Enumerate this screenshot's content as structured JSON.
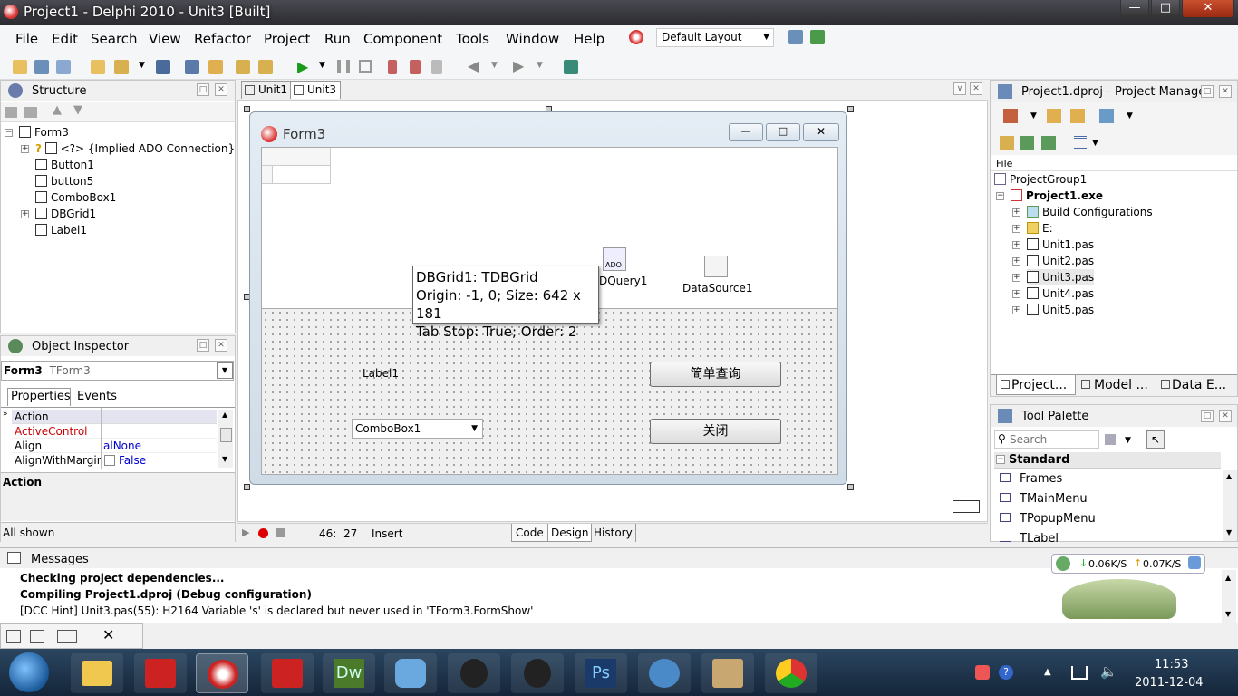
{
  "window": {
    "title": "Project1 - Delphi 2010 - Unit3 [Built]",
    "min": "—",
    "max": "□",
    "close": "✕"
  },
  "menu": [
    "File",
    "Edit",
    "Search",
    "View",
    "Refactor",
    "Project",
    "Run",
    "Component",
    "Tools",
    "Window",
    "Help"
  ],
  "layout_select": "Default Layout",
  "structure": {
    "title": "Structure",
    "items": [
      "Form3",
      "<?> {Implied ADO Connection}",
      "Button1",
      "button5",
      "ComboBox1",
      "DBGrid1",
      "Label1"
    ]
  },
  "inspector": {
    "title": "Object Inspector",
    "object_name": "Form3",
    "object_type": "TForm3",
    "tabs": [
      "Properties",
      "Events"
    ],
    "rows": [
      {
        "name": "Action",
        "value": ""
      },
      {
        "name": "ActiveControl",
        "value": ""
      },
      {
        "name": "Align",
        "value": "alNone"
      },
      {
        "name": "AlignWithMargins",
        "value": "False"
      }
    ],
    "desc_title": "Action",
    "status": "All shown"
  },
  "editor": {
    "tabs": [
      "Unit1",
      "Unit3"
    ],
    "form_title": "Form3",
    "tooltip": [
      "DBGrid1: TDBGrid",
      "Origin: -1, 0; Size: 642 x 181",
      "Tab Stop: True; Order: 2"
    ],
    "ado_label": "ADO",
    "query_label": "DQuery1",
    "datasource_label": "DataSource1",
    "label1": "Label1",
    "combo": "ComboBox1",
    "button_query": "简单查询",
    "button_close": "关闭",
    "status_pos": "46:  27",
    "status_mode": "Insert",
    "bottom_tabs": [
      "Code",
      "Design",
      "History"
    ]
  },
  "project_manager": {
    "title": "Project1.dproj - Project Manager",
    "column": "File",
    "items": [
      "ProjectGroup1",
      "Project1.exe",
      "Build Configurations",
      "E:",
      "Unit1.pas",
      "Unit2.pas",
      "Unit3.pas",
      "Unit4.pas",
      "Unit5.pas"
    ],
    "tabs": [
      "Project...",
      "Model ...",
      "Data E..."
    ]
  },
  "palette": {
    "title": "Tool Palette",
    "search_placeholder": "Search",
    "category": "Standard",
    "items": [
      "Frames",
      "TMainMenu",
      "TPopupMenu",
      "TLabel"
    ]
  },
  "messages": {
    "title": "Messages",
    "lines": [
      "Checking project dependencies...",
      "Compiling Project1.dproj (Debug configuration)",
      "[DCC Hint] Unit3.pas(55): H2164 Variable 's' is declared but never used in 'TForm3.FormShow'"
    ]
  },
  "netspeed": {
    "down": "0.06K/S",
    "up": "0.07K/S"
  },
  "taskbar": {
    "time": "11:53",
    "date": "2011-12-04"
  },
  "colors": {
    "accent": "#3a6ea5",
    "red": "#cc0000",
    "blue": "#0000cc"
  }
}
